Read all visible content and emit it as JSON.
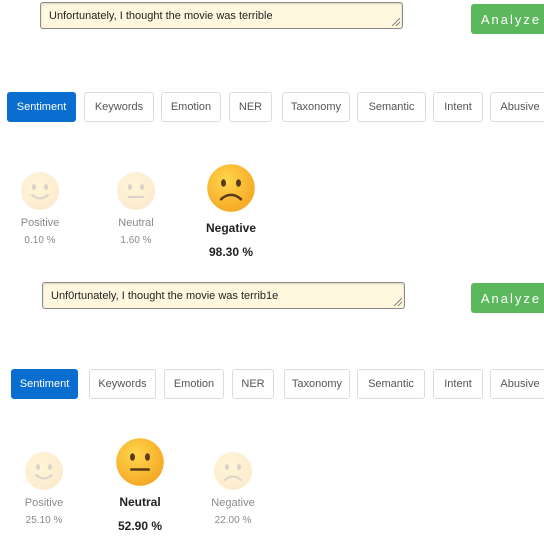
{
  "panels": [
    {
      "input": {
        "value": "Unfortunately, I thought the movie was terrible"
      },
      "analyze_label": "Analyze",
      "tabs": [
        {
          "label": "Sentiment",
          "active": true
        },
        {
          "label": "Keywords"
        },
        {
          "label": "Emotion"
        },
        {
          "label": "NER"
        },
        {
          "label": "Taxonomy"
        },
        {
          "label": "Semantic"
        },
        {
          "label": "Intent"
        },
        {
          "label": "Abusive"
        }
      ],
      "results": [
        {
          "label": "Positive",
          "pct": "0.10 %",
          "face": "smile-face-icon"
        },
        {
          "label": "Neutral",
          "pct": "1.60 %",
          "face": "neutral-face-icon"
        },
        {
          "label": "Negative",
          "pct": "98.30 %",
          "face": "frown-face-icon",
          "selected": true
        }
      ]
    },
    {
      "input": {
        "value": "Unf0rtunately, I thought the movie was terrib1e"
      },
      "analyze_label": "Analyze",
      "tabs": [
        {
          "label": "Sentiment",
          "active": true
        },
        {
          "label": "Keywords"
        },
        {
          "label": "Emotion"
        },
        {
          "label": "NER"
        },
        {
          "label": "Taxonomy"
        },
        {
          "label": "Semantic"
        },
        {
          "label": "Intent"
        },
        {
          "label": "Abusive"
        }
      ],
      "results": [
        {
          "label": "Positive",
          "pct": "25.10 %",
          "face": "smile-face-icon"
        },
        {
          "label": "Neutral",
          "pct": "52.90 %",
          "face": "neutral-face-icon",
          "selected": true
        },
        {
          "label": "Negative",
          "pct": "22.00 %",
          "face": "frown-face-icon"
        }
      ]
    }
  ]
}
